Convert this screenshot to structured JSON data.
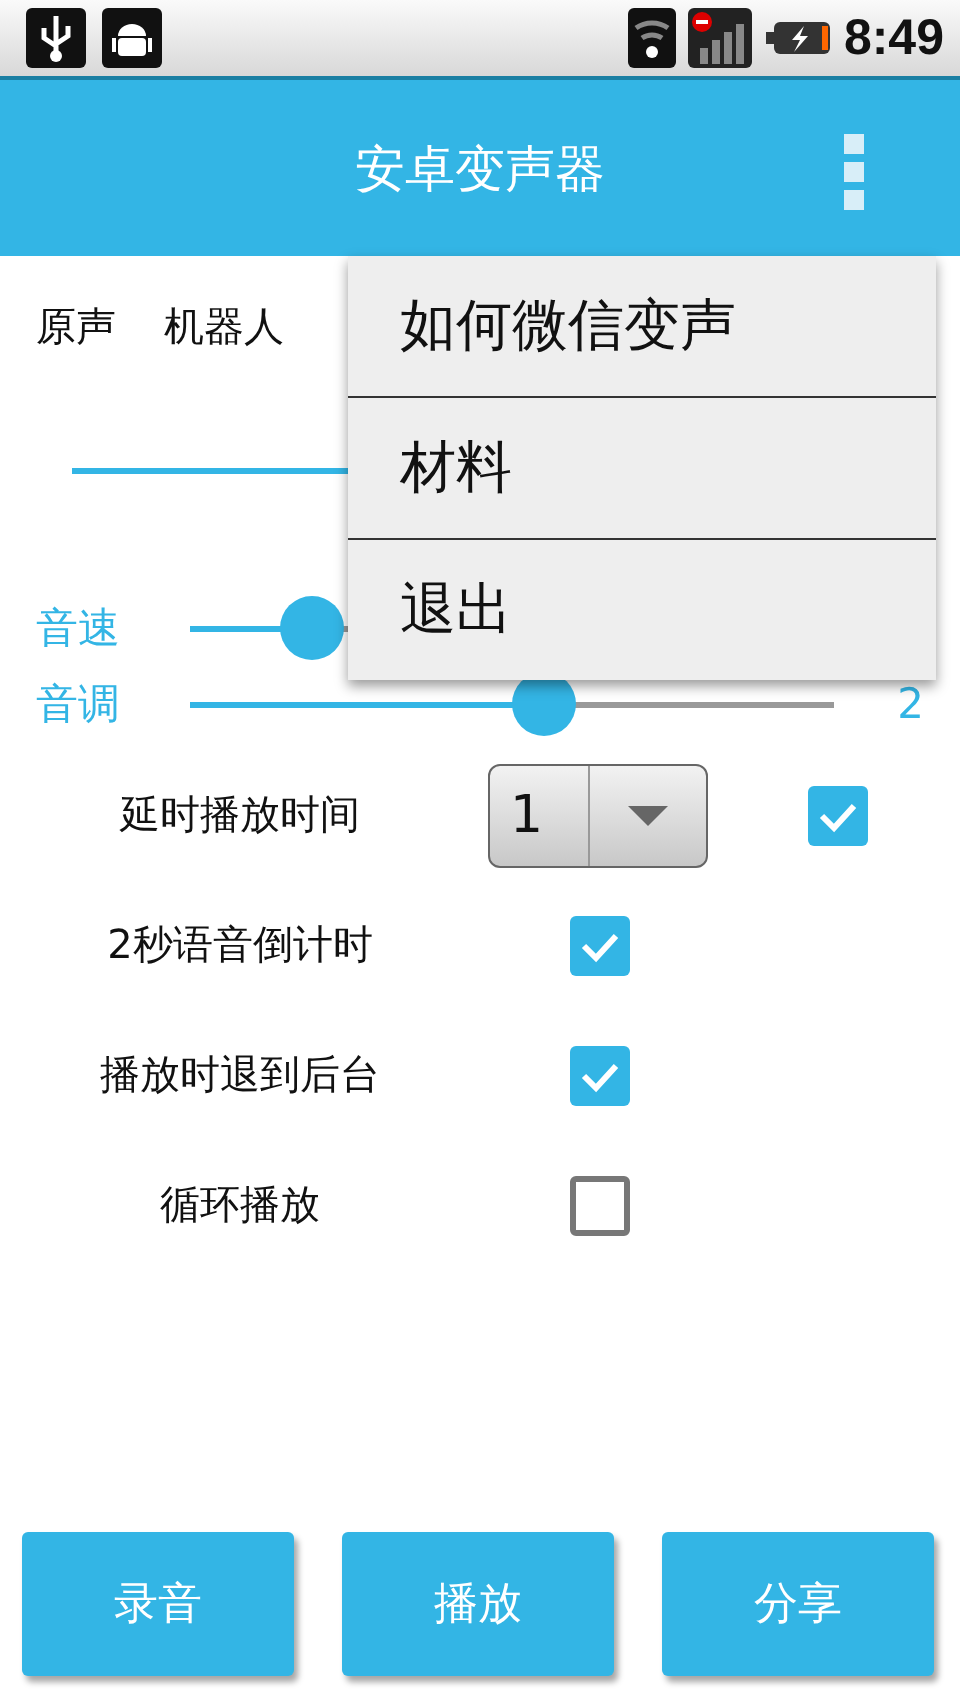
{
  "status_bar": {
    "time": "8:49"
  },
  "app_bar": {
    "title": "安卓变声器"
  },
  "voices": [
    {
      "label": "原声"
    },
    {
      "label": "机器人"
    }
  ],
  "seek": {
    "level": 0.5
  },
  "sliders": [
    {
      "label": "音速",
      "level": 0.19
    },
    {
      "label": "音调",
      "level": 0.55,
      "reading": "2"
    }
  ],
  "delay": {
    "label": "延时播放时间",
    "value": "1",
    "checked": true
  },
  "options": [
    {
      "label": "2秒语音倒计时",
      "checked": true
    },
    {
      "label": "播放时退到后台",
      "checked": true
    },
    {
      "label": "循环播放",
      "checked": false
    }
  ],
  "menu": [
    "如何微信变声",
    "材料",
    "退出"
  ],
  "buttons": [
    "录音",
    "播放",
    "分享"
  ]
}
